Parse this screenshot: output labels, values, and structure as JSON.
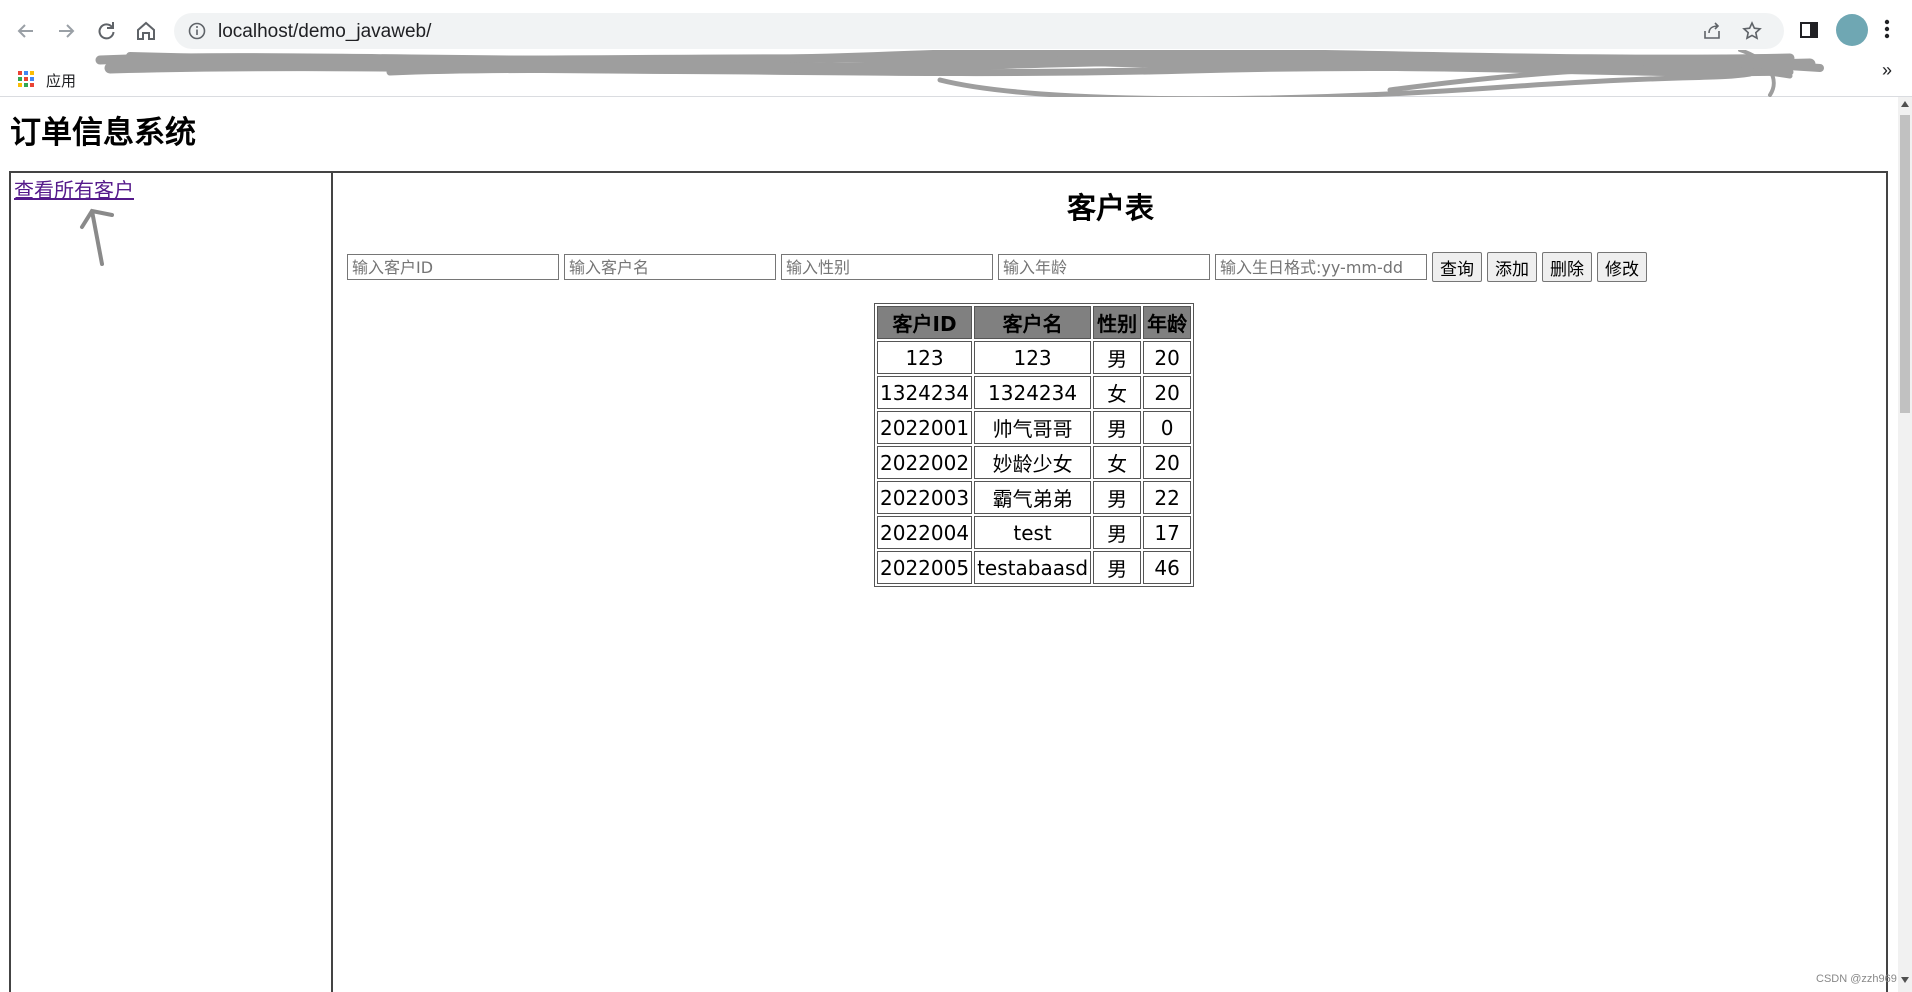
{
  "browser": {
    "url": "localhost/demo_javaweb/",
    "bookmarks_apps_label": "应用",
    "more_bookmarks": "»"
  },
  "page": {
    "title": "订单信息系统",
    "nav_link": "查看所有客户",
    "table_title": "客户表"
  },
  "search": {
    "id_placeholder": "输入客户ID",
    "name_placeholder": "输入客户名",
    "gender_placeholder": "输入性别",
    "age_placeholder": "输入年龄",
    "birthday_placeholder": "输入生日格式:yy-mm-dd"
  },
  "buttons": {
    "query": "查询",
    "add": "添加",
    "delete": "删除",
    "modify": "修改"
  },
  "table": {
    "headers": [
      "客户ID",
      "客户名",
      "性别",
      "年龄"
    ],
    "rows": [
      [
        "123",
        "123",
        "男",
        "20"
      ],
      [
        "1324234",
        "1324234",
        "女",
        "20"
      ],
      [
        "2022001",
        "帅气哥哥",
        "男",
        "0"
      ],
      [
        "2022002",
        "妙龄少女",
        "女",
        "20"
      ],
      [
        "2022003",
        "霸气弟弟",
        "男",
        "22"
      ],
      [
        "2022004",
        "test",
        "男",
        "17"
      ],
      [
        "2022005",
        "testabaasd",
        "男",
        "46"
      ]
    ]
  },
  "watermark": "CSDN @zzh969",
  "colors": {
    "header_bg": "#808080",
    "link": "#551a8b",
    "omnibox_bg": "#f1f3f4",
    "redaction_scribble": "#9e9e9e"
  },
  "icons": [
    "back-icon",
    "forward-icon",
    "reload-icon",
    "home-icon",
    "info-icon",
    "share-icon",
    "star-icon",
    "side-panel-icon",
    "profile-icon",
    "menu-icon",
    "apps-icon",
    "annotation-arrow-icon"
  ]
}
